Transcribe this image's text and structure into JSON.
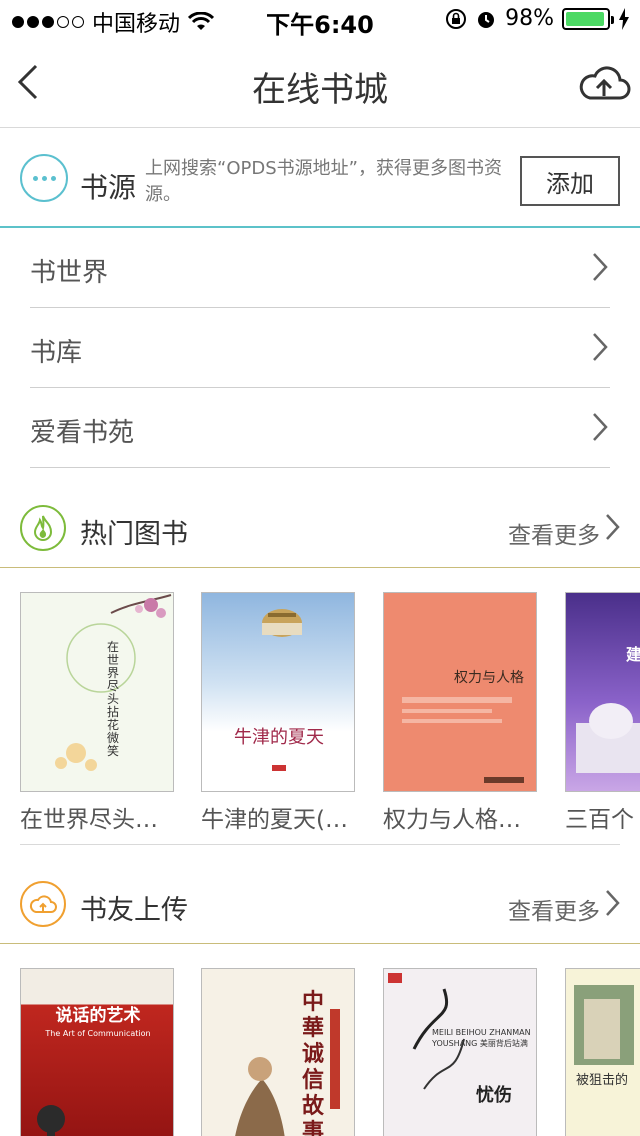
{
  "status_bar": {
    "carrier": "中国移动",
    "time": "下午6:40",
    "battery": "98%",
    "battery_level": 0.98
  },
  "nav": {
    "title": "在线书城"
  },
  "source": {
    "title": "书源",
    "description": "上网搜索“OPDS书源地址”，获得更多图书资源。",
    "add_label": "添加"
  },
  "list": [
    {
      "label": "书世界"
    },
    {
      "label": "书库"
    },
    {
      "label": "爱看书苑"
    }
  ],
  "hot": {
    "title": "热门图书",
    "more": "查看更多",
    "books": [
      {
        "title": "在世界尽头…",
        "cover_text": "在世界尽头 拈花微笑"
      },
      {
        "title": "牛津的夏天(…",
        "cover_text": "牛津的夏天"
      },
      {
        "title": "权力与人格…",
        "cover_text": "权力与人格"
      },
      {
        "title": "三百个",
        "cover_text": "建"
      }
    ]
  },
  "upload": {
    "title": "书友上传",
    "more": "查看更多",
    "books": [
      {
        "cover_text": "说话的艺术",
        "cover_sub": "The Art of Communication"
      },
      {
        "cover_text": "中華 诚信 故事"
      },
      {
        "cover_text": "忧伤",
        "cover_sub": "MEILI BEIHOU ZHANMAN YOUSHANG 美丽背后站满"
      },
      {
        "cover_text": "被狙击的"
      }
    ]
  },
  "colors": {
    "accent_teal": "#5bc0cf",
    "accent_green": "#7dbb3b",
    "accent_orange": "#f0a030",
    "battery_green": "#4cd964"
  }
}
